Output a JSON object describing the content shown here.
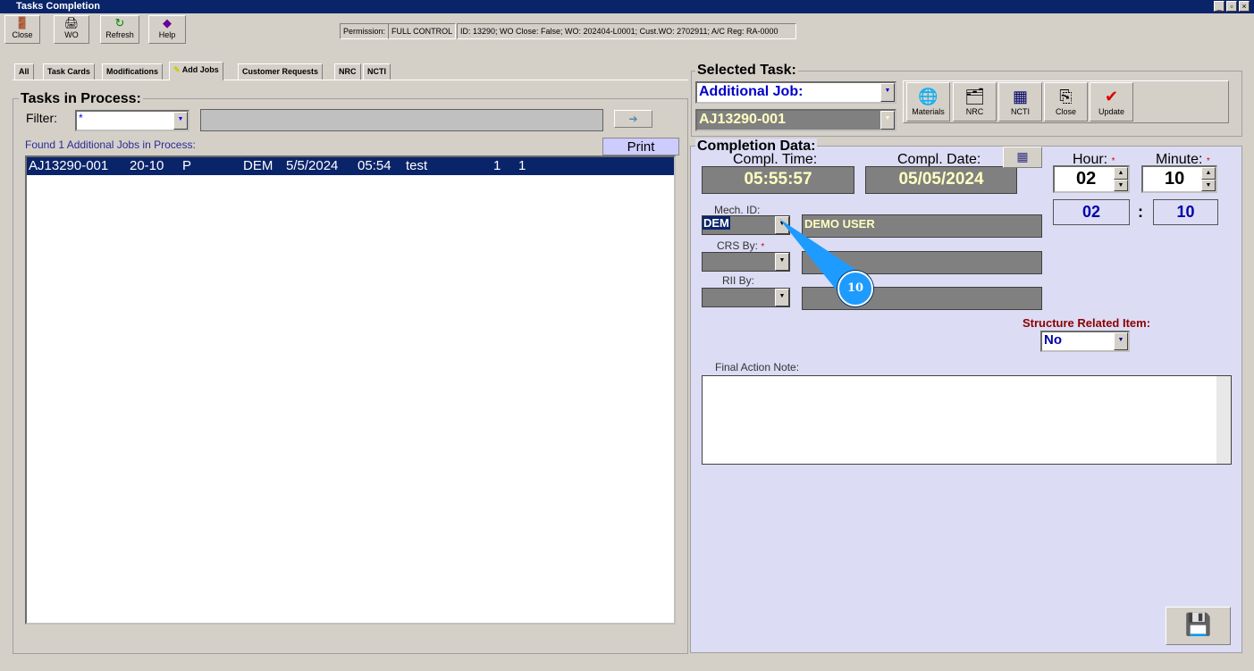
{
  "window": {
    "title": "Tasks Completion"
  },
  "toolbar": {
    "close": "Close",
    "wo": "WO",
    "refresh": "Refresh",
    "help": "Help"
  },
  "info": {
    "permission_label": "Permission:",
    "permission_value": "FULL CONTROL",
    "details": "ID: 13290; WO Close: False; WO: 202404-L0001; Cust.WO: 2702911; A/C Reg: RA-0000"
  },
  "tabs": [
    "All",
    "Task Cards",
    "Modifications",
    "Add Jobs",
    "Customer Requests",
    "NRC",
    "NCTI"
  ],
  "tasks": {
    "title": "Tasks in Process:",
    "filter_label": "Filter:",
    "filter_value": "*",
    "found_text": "Found 1 Additional Jobs in Process:",
    "print": "Print",
    "rows": [
      {
        "id": "AJ13290-001",
        "ata": "20-10",
        "status": "P",
        "mech": "DEM",
        "date": "5/5/2024",
        "time": "05:54",
        "desc": "test",
        "c1": "1",
        "c2": "1"
      }
    ]
  },
  "selected": {
    "title": "Selected Task:",
    "type": "Additional Job:",
    "task_id": "AJ13290-001",
    "buttons": {
      "materials": "Materials",
      "nrc": "NRC",
      "ncti": "NCTI",
      "close": "Close",
      "update": "Update"
    }
  },
  "completion": {
    "title": "Completion Data:",
    "time_label": "Compl. Time:",
    "time_value": "05:55:57",
    "date_label": "Compl. Date:",
    "date_value": "05/05/2024",
    "hour_label": "Hour:",
    "minute_label": "Minute:",
    "hour": "02",
    "minute": "10",
    "hour_display": "02",
    "minute_display": "10",
    "colon": ":",
    "req": "*",
    "mech_label": "Mech. ID:",
    "mech_value": "DEM",
    "mech_name": "DEMO USER",
    "crs_label": "CRS By:",
    "rii_label": "RII By:",
    "structure_label": "Structure Related Item:",
    "structure_value": "No",
    "note_label": "Final Action Note:"
  },
  "callout": {
    "number": "10"
  }
}
